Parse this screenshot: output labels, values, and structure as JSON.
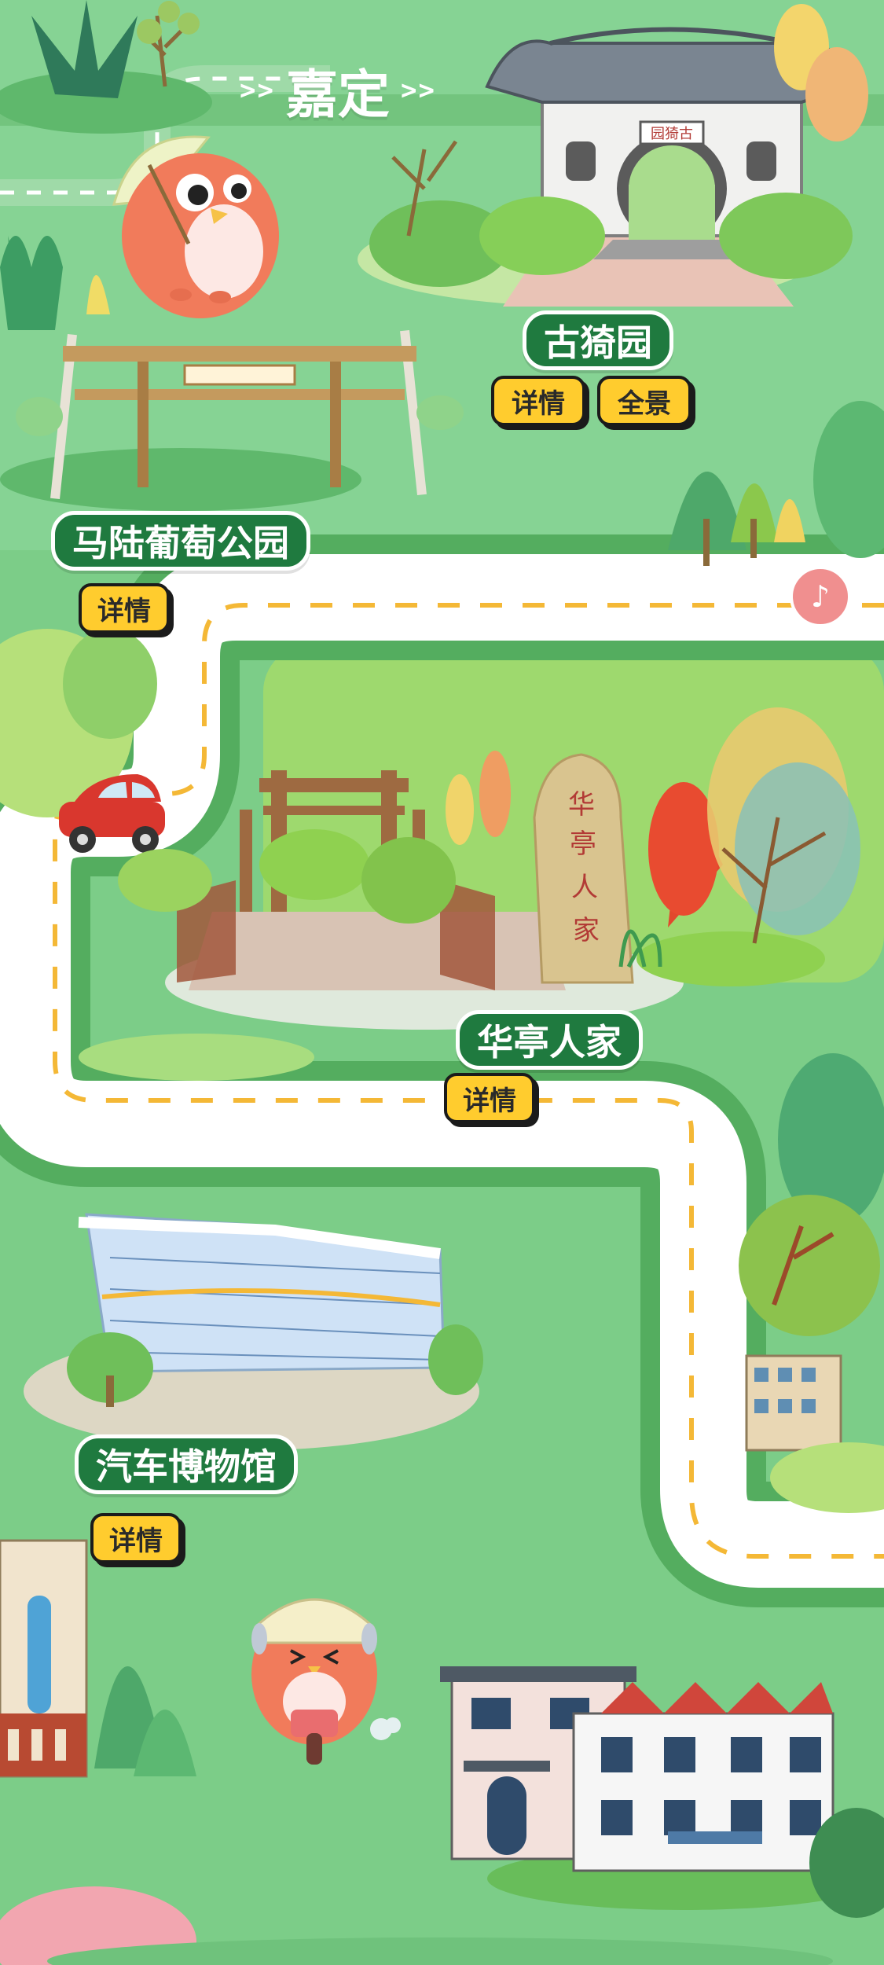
{
  "header": {
    "arrows_left": ">>",
    "title": "嘉定",
    "arrows_right": ">>"
  },
  "places": [
    {
      "name": "古猗园",
      "buttons": [
        "详情",
        "全景"
      ]
    },
    {
      "name": "马陆葡萄公园",
      "buttons": [
        "详情"
      ]
    },
    {
      "name": "华亭人家",
      "buttons": [
        "详情"
      ]
    },
    {
      "name": "汽车博物馆",
      "buttons": [
        "详情"
      ]
    }
  ],
  "signs": {
    "guyi_plaque": "园猗古",
    "huating_stone": [
      "华",
      "亭",
      "人",
      "家"
    ]
  },
  "music_icon": "♪",
  "colors": {
    "grass": "#7fd08a",
    "road": "#ffffff",
    "road_dash": "#f4b836",
    "label_bg": "#1f7a3f",
    "button": "#ffcc2e"
  }
}
